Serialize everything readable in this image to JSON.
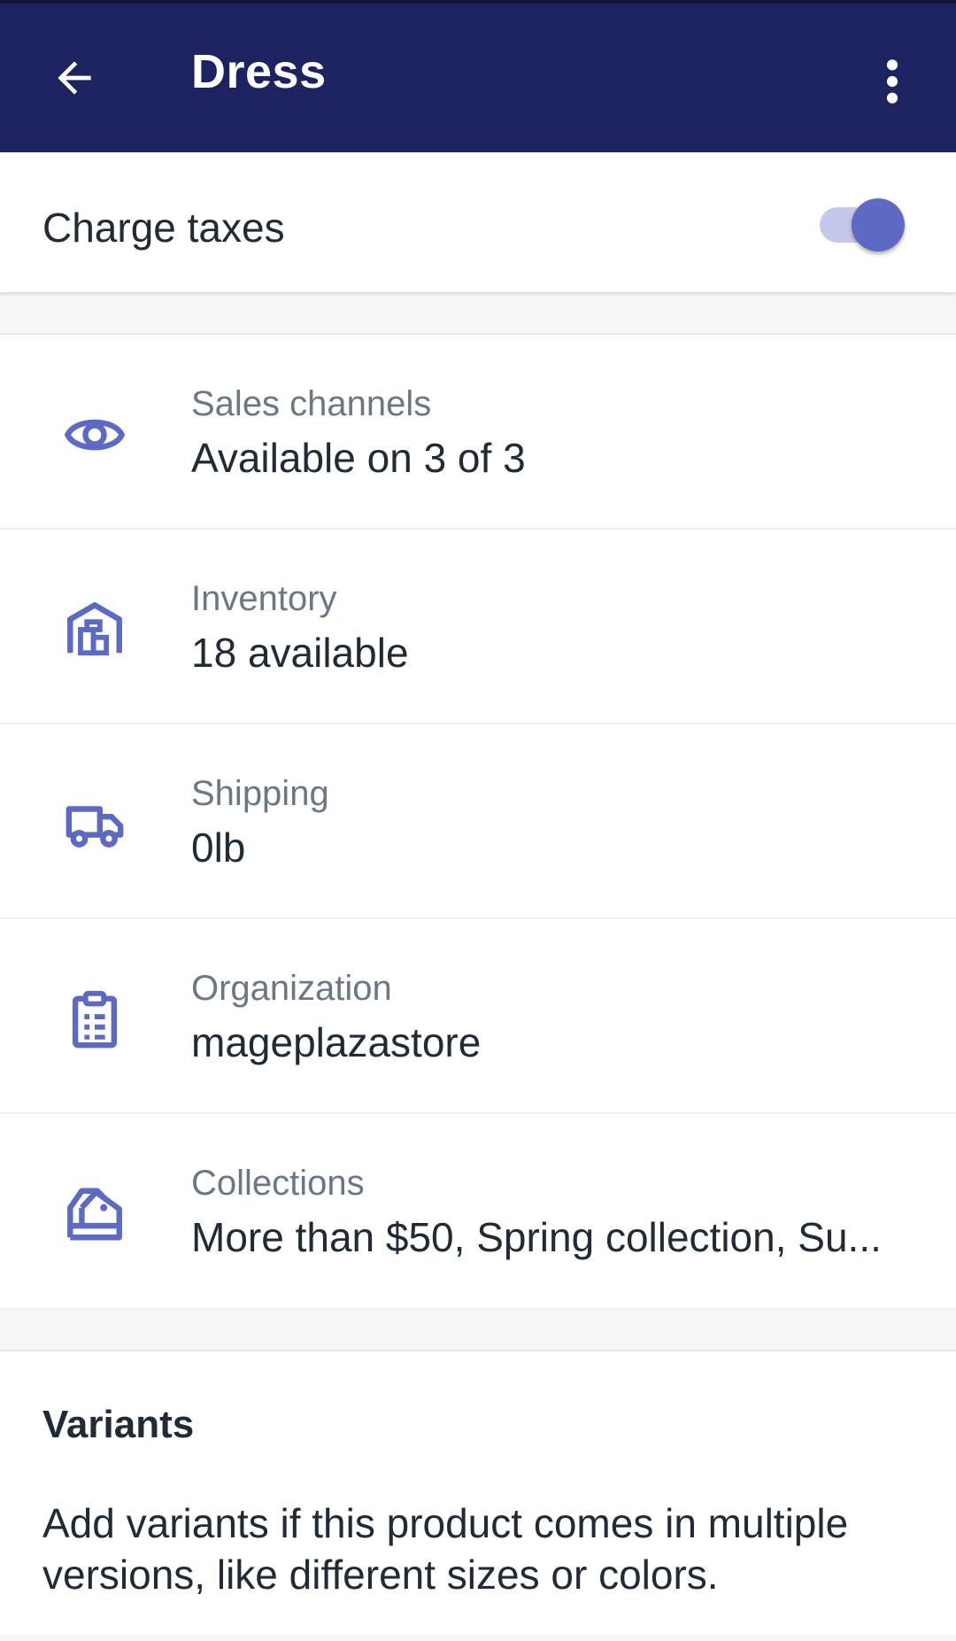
{
  "header": {
    "title": "Dress",
    "back_icon": "arrow-left-icon",
    "menu_icon": "more-vertical-icon"
  },
  "tax": {
    "label": "Charge taxes",
    "enabled": true
  },
  "details": [
    {
      "icon": "eye-icon",
      "label": "Sales channels",
      "value": "Available on 3 of 3"
    },
    {
      "icon": "warehouse-icon",
      "label": "Inventory",
      "value": "18 available"
    },
    {
      "icon": "truck-icon",
      "label": "Shipping",
      "value": "0lb"
    },
    {
      "icon": "clipboard-icon",
      "label": "Organization",
      "value": "mageplazastore"
    },
    {
      "icon": "collection-tag-icon",
      "label": "Collections",
      "value": "More than $50, Spring collection, Su..."
    }
  ],
  "variants": {
    "heading": "Variants",
    "description": "Add variants if this product comes in multiple versions, like different sizes or colors."
  },
  "colors": {
    "app_bar": "#1d2260",
    "accent": "#5c6ac4",
    "text": "#212b36",
    "muted": "#6b7785"
  }
}
